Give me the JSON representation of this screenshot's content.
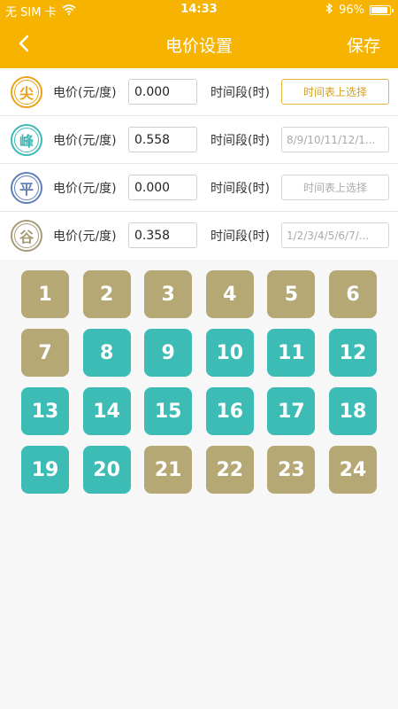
{
  "status_bar": {
    "carrier": "无 SIM 卡",
    "time": "14:33",
    "battery_label": "96%",
    "battery_level": 0.96,
    "icons": [
      "wifi-icon",
      "bluetooth-icon",
      "battery-icon"
    ]
  },
  "nav": {
    "back_icon": "chevron-left-icon",
    "title": "电价设置",
    "save_label": "保存"
  },
  "colors": {
    "brand": "#f6b400",
    "off_peak_cell": "#b6a874",
    "peak_cell": "#3dbcb6"
  },
  "price_rows": [
    {
      "badge": "尖",
      "badge_color": "#eaa21a",
      "price_label": "电价(元/度)",
      "price_value": "0.000",
      "period_label": "时间段(时)",
      "period_value": "",
      "period_placeholder": "时间表上选择",
      "active": true
    },
    {
      "badge": "峰",
      "badge_color": "#3cb9b6",
      "price_label": "电价(元/度)",
      "price_value": "0.558",
      "period_label": "时间段(时)",
      "period_value": "8/9/10/11/12/1...",
      "period_placeholder": "",
      "active": false
    },
    {
      "badge": "平",
      "badge_color": "#5e7fb8",
      "price_label": "电价(元/度)",
      "price_value": "0.000",
      "period_label": "时间段(时)",
      "period_value": "",
      "period_placeholder": "时间表上选择",
      "active": false
    },
    {
      "badge": "谷",
      "badge_color": "#a69b78",
      "price_label": "电价(元/度)",
      "price_value": "0.358",
      "period_label": "时间段(时)",
      "period_value": "1/2/3/4/5/6/7/...",
      "period_placeholder": "",
      "active": false
    }
  ],
  "hours": [
    {
      "label": "1",
      "type": "valley"
    },
    {
      "label": "2",
      "type": "valley"
    },
    {
      "label": "3",
      "type": "valley"
    },
    {
      "label": "4",
      "type": "valley"
    },
    {
      "label": "5",
      "type": "valley"
    },
    {
      "label": "6",
      "type": "valley"
    },
    {
      "label": "7",
      "type": "valley"
    },
    {
      "label": "8",
      "type": "peak"
    },
    {
      "label": "9",
      "type": "peak"
    },
    {
      "label": "10",
      "type": "peak"
    },
    {
      "label": "11",
      "type": "peak"
    },
    {
      "label": "12",
      "type": "peak"
    },
    {
      "label": "13",
      "type": "peak"
    },
    {
      "label": "14",
      "type": "peak"
    },
    {
      "label": "15",
      "type": "peak"
    },
    {
      "label": "16",
      "type": "peak"
    },
    {
      "label": "17",
      "type": "peak"
    },
    {
      "label": "18",
      "type": "peak"
    },
    {
      "label": "19",
      "type": "peak"
    },
    {
      "label": "20",
      "type": "peak"
    },
    {
      "label": "21",
      "type": "valley"
    },
    {
      "label": "22",
      "type": "valley"
    },
    {
      "label": "23",
      "type": "valley"
    },
    {
      "label": "24",
      "type": "valley"
    }
  ]
}
